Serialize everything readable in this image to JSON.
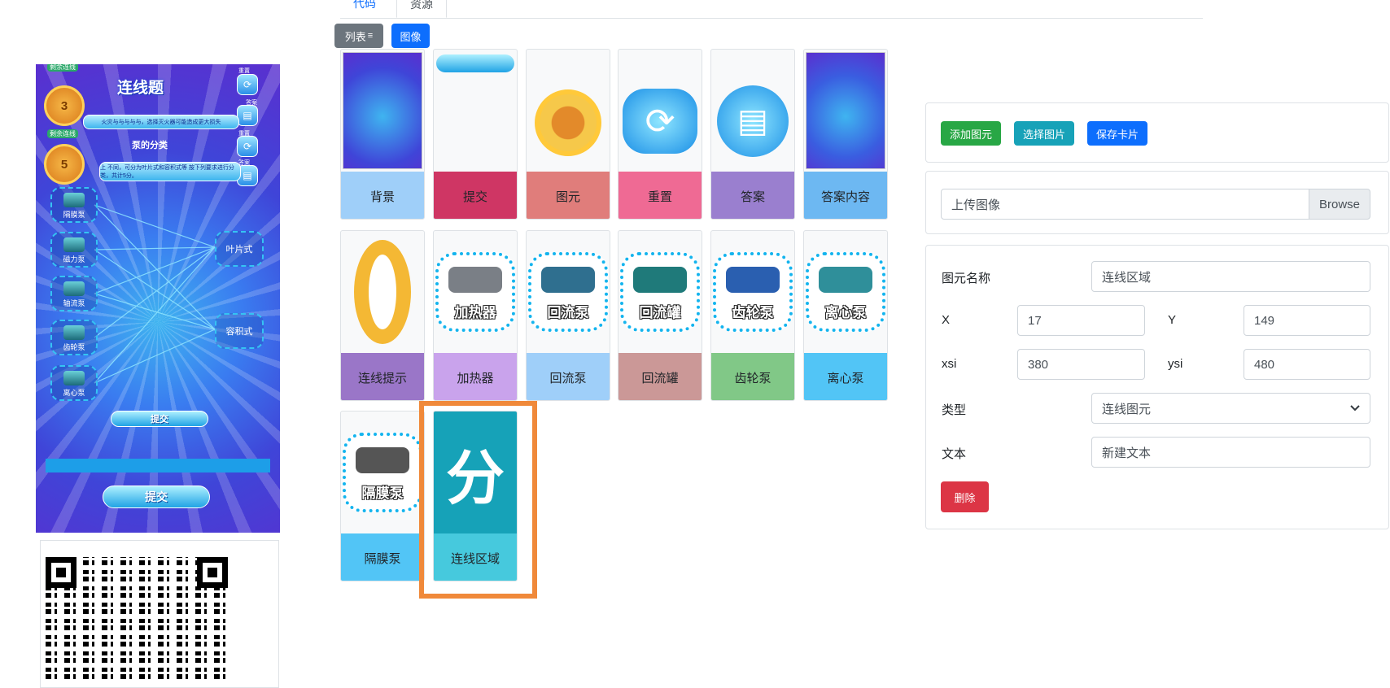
{
  "tabs": [
    {
      "label": "代码"
    },
    {
      "label": "资源"
    }
  ],
  "view_buttons": {
    "list": "列表",
    "list_icon": "≡",
    "image": "图像"
  },
  "resources": [
    {
      "name": "背景",
      "thumb": "background-image",
      "color": "#9fcff9"
    },
    {
      "name": "提交",
      "thumb": "提交",
      "color": "#cf3664"
    },
    {
      "name": "图元",
      "thumb": "剩余连线",
      "color": "#e07d7b"
    },
    {
      "name": "重置",
      "thumb": "重置",
      "color": "#ef6a94"
    },
    {
      "name": "答案",
      "thumb": "答案",
      "color": "#9a7fcf"
    },
    {
      "name": "答案内容",
      "thumb": "answer-screenshot",
      "color": "#6db8f2"
    },
    {
      "name": "连线提示",
      "thumb": "0",
      "color": "#9a76c8"
    },
    {
      "name": "加热器",
      "thumb": "加热器",
      "color": "#c9a3ec"
    },
    {
      "name": "回流泵",
      "thumb": "回流泵",
      "color": "#9fcff9"
    },
    {
      "name": "回流罐",
      "thumb": "回流罐",
      "color": "#cb9897"
    },
    {
      "name": "齿轮泵",
      "thumb": "齿轮泵",
      "color": "#81c887"
    },
    {
      "name": "离心泵",
      "thumb": "离心泵",
      "color": "#52c5f6"
    },
    {
      "name": "隔膜泵",
      "thumb": "隔膜泵",
      "color": "#52c5f6"
    },
    {
      "name": "连线区域",
      "thumb": "分",
      "color": "#46c9dd",
      "selected": true
    }
  ],
  "toolbar": {
    "add_element": "添加图元",
    "choose_image": "选择图片",
    "save_card": "保存卡片"
  },
  "upload": {
    "placeholder": "上传图像",
    "browse": "Browse"
  },
  "props": {
    "name_label": "图元名称",
    "name_value": "连线区域",
    "x_label": "X",
    "x_value": "17",
    "y_label": "Y",
    "y_value": "149",
    "xsi_label": "xsi",
    "xsi_value": "380",
    "ysi_label": "ysi",
    "ysi_value": "480",
    "type_label": "类型",
    "type_value": "连线图元",
    "text_label": "文本",
    "text_value": "新建文本",
    "delete_label": "删除"
  },
  "preview": {
    "title": "连线题",
    "remaining_label": "剩余连线",
    "remaining_back": "3",
    "remaining_front": "5",
    "instruction": "火灾与与与与与，选择灭火器可能造成更大损失",
    "instruction2": "上 不同，可分为叶片式和容积式等 按下列要求进行分类，共计5分。",
    "subtitle": "泵的分类",
    "reset_label": "重置",
    "answer_label": "答案",
    "items": [
      "隔膜泵",
      "磁力泵",
      "轴流泵",
      "齿轮泵",
      "离心泵"
    ],
    "targets": [
      "叶片式",
      "容积式"
    ],
    "submit_small": "提交",
    "submit_big": "提交"
  },
  "colors": {
    "green": "#28a745",
    "teal": "#17a2b8",
    "blue": "#0d6efd",
    "red": "#dc3545",
    "grey": "#6c757d",
    "highlight": "#f0893a"
  }
}
